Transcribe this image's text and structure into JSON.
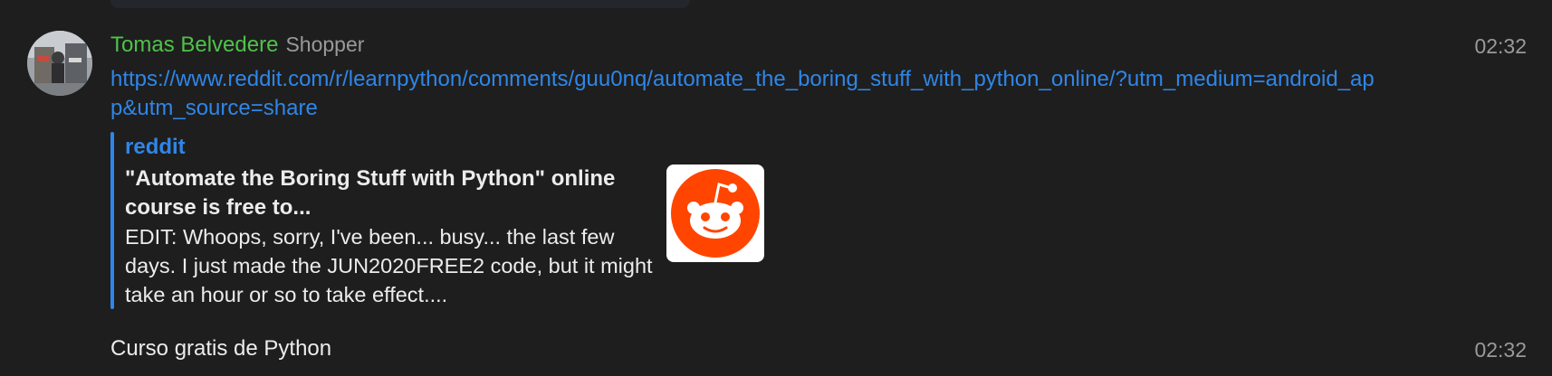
{
  "message1": {
    "sender_name": "Tomas Belvedere",
    "sender_tag": "Shopper",
    "time": "02:32",
    "link_text": "https://www.reddit.com/r/learnpython/comments/guu0nq/automate_the_boring_stuff_with_python_online/?utm_medium=android_app&utm_source=share",
    "preview": {
      "site_name": "reddit",
      "title": "\"Automate the Boring Stuff with Python\" online course is free to...",
      "description": "EDIT: Whoops, sorry, I've been... busy... the last few days. I just made the JUN2020FREE2 code, but it might take an hour or so to take effect....",
      "thumbnail_icon": "reddit-logo-icon"
    }
  },
  "message2": {
    "text": "Curso gratis de Python",
    "time": "02:32"
  },
  "colors": {
    "background": "#1e1e1e",
    "sender_name": "#4fc24a",
    "link": "#2f86e8",
    "muted": "#9a9a9a",
    "text": "#ececec",
    "reddit_orange": "#ff4500"
  }
}
